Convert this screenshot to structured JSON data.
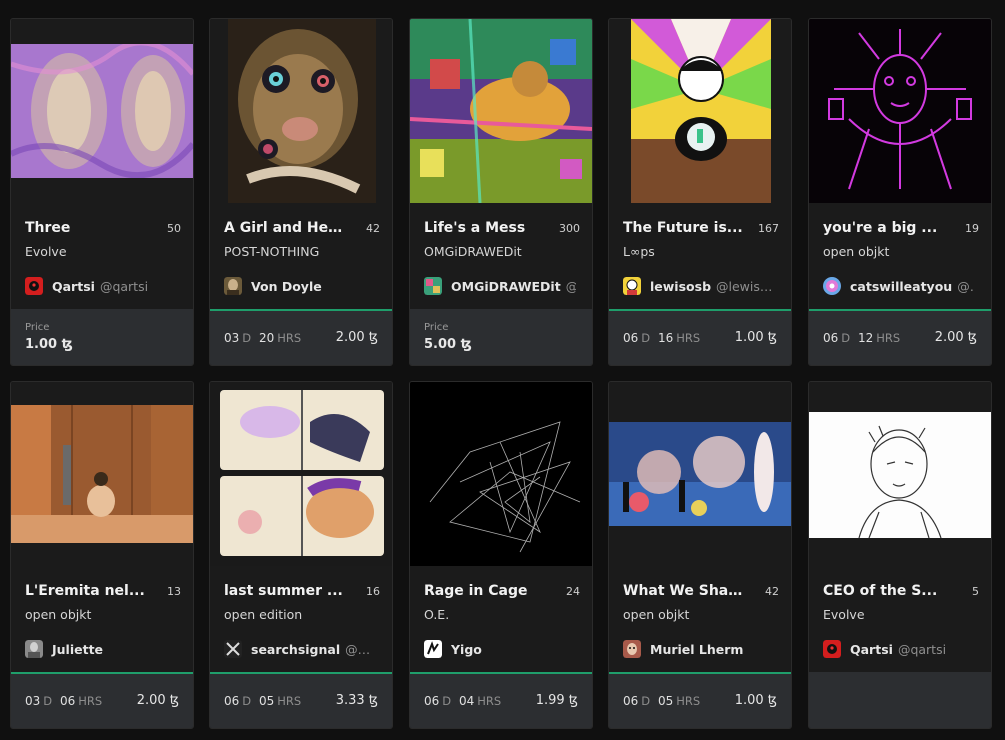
{
  "cards": [
    {
      "title": "Three",
      "count": "50",
      "collection": "Evolve",
      "artist": "Qartsi",
      "handle": "@qartsi",
      "timer": null,
      "price_label": "Price",
      "price": "1.00 ꜩ"
    },
    {
      "title": "A Girl and He...",
      "count": "42",
      "collection": "POST-NOTHING",
      "artist": "Von Doyle",
      "handle": "",
      "timer": {
        "days": "03",
        "hours": "20",
        "d_unit": "D",
        "h_unit": "HRS"
      },
      "price": "2.00 ꜩ"
    },
    {
      "title": "Life's a Mess",
      "count": "300",
      "collection": "OMGiDRAWEDit",
      "artist": "OMGiDRAWEDit",
      "handle": "@...",
      "timer": null,
      "price_label": "Price",
      "price": "5.00 ꜩ"
    },
    {
      "title": "The Future is...",
      "count": "167",
      "collection": "L∞ps",
      "artist": "lewisosb",
      "handle": "@lewisosb",
      "timer": {
        "days": "06",
        "hours": "16",
        "d_unit": "D",
        "h_unit": "HRS"
      },
      "price": "1.00 ꜩ"
    },
    {
      "title": "you're a big ...",
      "count": "19",
      "collection": "open objkt",
      "artist": "catswilleatyou",
      "handle": "@c...",
      "timer": {
        "days": "06",
        "hours": "12",
        "d_unit": "D",
        "h_unit": "HRS"
      },
      "price": "2.00 ꜩ"
    },
    {
      "title": "L'Eremita nel...",
      "count": "13",
      "collection": "open objkt",
      "artist": "Juliette",
      "handle": "",
      "timer": {
        "days": "03",
        "hours": "06",
        "d_unit": "D",
        "h_unit": "HRS"
      },
      "price": "2.00 ꜩ"
    },
    {
      "title": "last summer ...",
      "count": "16",
      "collection": "open edition",
      "artist": "searchsignal",
      "handle": "@sea...",
      "timer": {
        "days": "06",
        "hours": "05",
        "d_unit": "D",
        "h_unit": "HRS"
      },
      "price": "3.33 ꜩ"
    },
    {
      "title": "Rage in Cage",
      "count": "24",
      "collection": "O.E.",
      "artist": "Yigo",
      "handle": "",
      "timer": {
        "days": "06",
        "hours": "04",
        "d_unit": "D",
        "h_unit": "HRS"
      },
      "price": "1.99 ꜩ"
    },
    {
      "title": "What We Sha...",
      "count": "42",
      "collection": "open objkt",
      "artist": "Muriel Lherm",
      "handle": "",
      "timer": {
        "days": "06",
        "hours": "05",
        "d_unit": "D",
        "h_unit": "HRS"
      },
      "price": "1.00 ꜩ"
    },
    {
      "title": "CEO of the S...",
      "count": "5",
      "collection": "Evolve",
      "artist": "Qartsi",
      "handle": "@qartsi",
      "timer": null,
      "price": null
    }
  ],
  "colors": {
    "live_border": "#1f9e6b",
    "footer_bg": "#2c2e31",
    "card_bg": "#1b1b1b",
    "page_bg": "#101010"
  }
}
